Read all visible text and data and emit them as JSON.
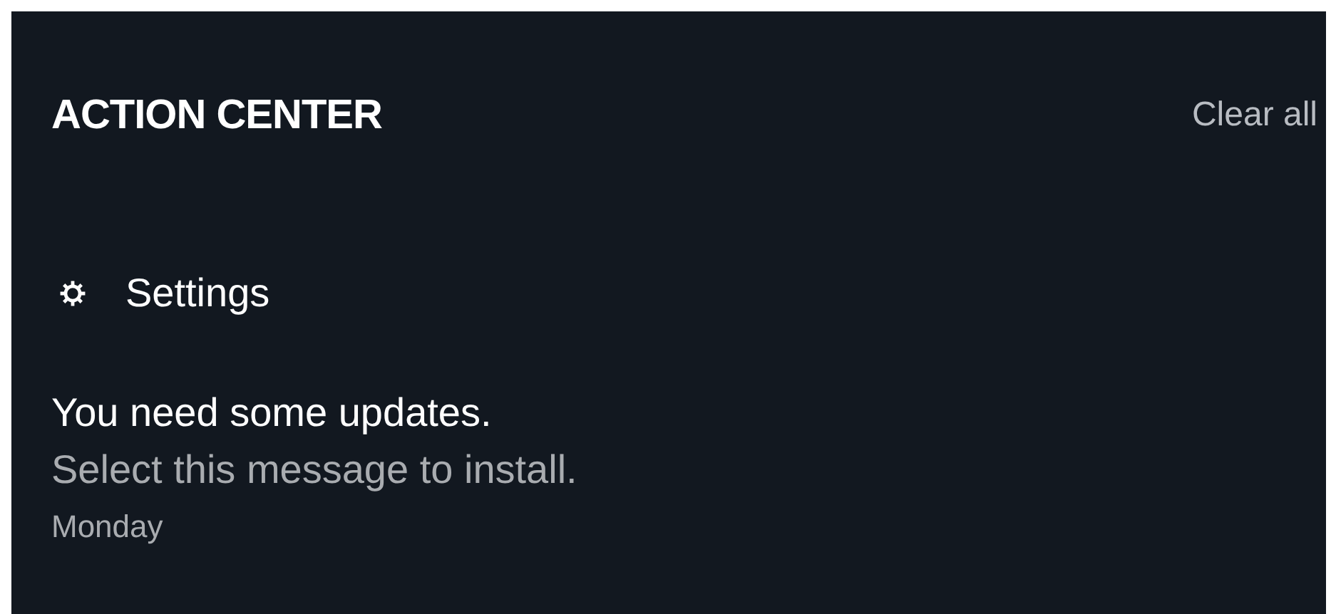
{
  "header": {
    "title": "ACTION CENTER",
    "clear_button": "Clear all"
  },
  "group": {
    "label": "Settings"
  },
  "notification": {
    "title": "You need some updates.",
    "body": "Select this message to install.",
    "time": "Monday"
  }
}
